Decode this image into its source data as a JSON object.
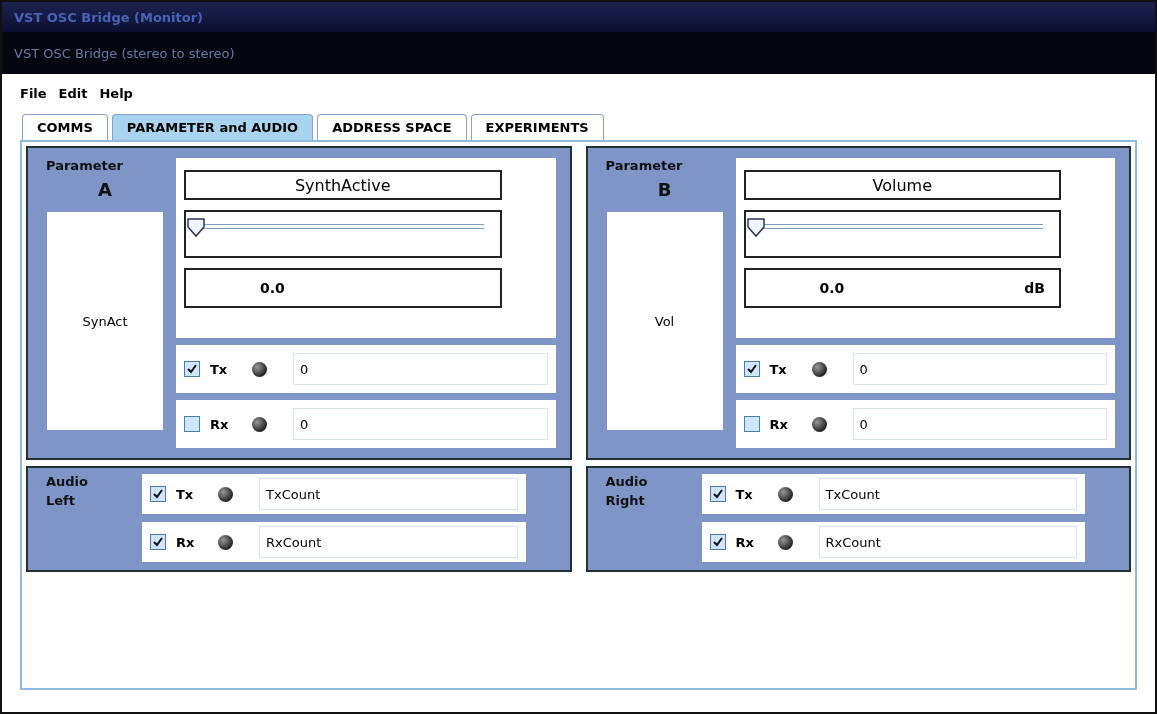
{
  "window": {
    "title": "VST OSC Bridge (Monitor)",
    "subtitle": "VST OSC Bridge (stereo to stereo)"
  },
  "menu": [
    "File",
    "Edit",
    "Help"
  ],
  "tabs": [
    {
      "label": "COMMS",
      "selected": false
    },
    {
      "label": "PARAMETER and AUDIO",
      "selected": true
    },
    {
      "label": "ADDRESS SPACE",
      "selected": false
    },
    {
      "label": "EXPERIMENTS",
      "selected": false
    }
  ],
  "parameters": [
    {
      "heading": "Parameter",
      "letter": "A",
      "short_name": "SynAct",
      "name": "SynthActive",
      "level": 0,
      "value": "0.0",
      "channels": [
        {
          "label": "Tx",
          "checked": true,
          "count": "0"
        },
        {
          "label": "Rx",
          "checked": false,
          "count": "0"
        }
      ]
    },
    {
      "heading": "Parameter",
      "letter": "B",
      "short_name": "Vol",
      "name": "Volume",
      "level": 0,
      "value": "0.0",
      "unit": "dB",
      "channels": [
        {
          "label": "Tx",
          "checked": true,
          "count": "0"
        },
        {
          "label": "Rx",
          "checked": false,
          "count": "0"
        }
      ]
    }
  ],
  "audio": [
    {
      "heading": "Audio",
      "side": "Left",
      "channels": [
        {
          "label": "Tx",
          "checked": true,
          "count": "TxCount"
        },
        {
          "label": "Rx",
          "checked": true,
          "count": "RxCount"
        }
      ]
    },
    {
      "heading": "Audio",
      "side": "Right",
      "channels": [
        {
          "label": "Tx",
          "checked": true,
          "count": "TxCount"
        },
        {
          "label": "Rx",
          "checked": true,
          "count": "RxCount"
        }
      ]
    }
  ]
}
